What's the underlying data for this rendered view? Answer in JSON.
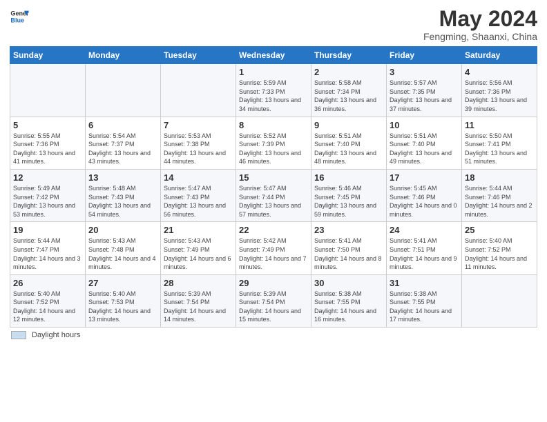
{
  "logo": {
    "line1": "General",
    "line2": "Blue"
  },
  "title": "May 2024",
  "subtitle": "Fengming, Shaanxi, China",
  "header": {
    "days": [
      "Sunday",
      "Monday",
      "Tuesday",
      "Wednesday",
      "Thursday",
      "Friday",
      "Saturday"
    ]
  },
  "footer": {
    "legend_label": "Daylight hours"
  },
  "weeks": [
    [
      {
        "day": "",
        "info": ""
      },
      {
        "day": "",
        "info": ""
      },
      {
        "day": "",
        "info": ""
      },
      {
        "day": "1",
        "info": "Sunrise: 5:59 AM\nSunset: 7:33 PM\nDaylight: 13 hours\nand 34 minutes."
      },
      {
        "day": "2",
        "info": "Sunrise: 5:58 AM\nSunset: 7:34 PM\nDaylight: 13 hours\nand 36 minutes."
      },
      {
        "day": "3",
        "info": "Sunrise: 5:57 AM\nSunset: 7:35 PM\nDaylight: 13 hours\nand 37 minutes."
      },
      {
        "day": "4",
        "info": "Sunrise: 5:56 AM\nSunset: 7:36 PM\nDaylight: 13 hours\nand 39 minutes."
      }
    ],
    [
      {
        "day": "5",
        "info": "Sunrise: 5:55 AM\nSunset: 7:36 PM\nDaylight: 13 hours\nand 41 minutes."
      },
      {
        "day": "6",
        "info": "Sunrise: 5:54 AM\nSunset: 7:37 PM\nDaylight: 13 hours\nand 43 minutes."
      },
      {
        "day": "7",
        "info": "Sunrise: 5:53 AM\nSunset: 7:38 PM\nDaylight: 13 hours\nand 44 minutes."
      },
      {
        "day": "8",
        "info": "Sunrise: 5:52 AM\nSunset: 7:39 PM\nDaylight: 13 hours\nand 46 minutes."
      },
      {
        "day": "9",
        "info": "Sunrise: 5:51 AM\nSunset: 7:40 PM\nDaylight: 13 hours\nand 48 minutes."
      },
      {
        "day": "10",
        "info": "Sunrise: 5:51 AM\nSunset: 7:40 PM\nDaylight: 13 hours\nand 49 minutes."
      },
      {
        "day": "11",
        "info": "Sunrise: 5:50 AM\nSunset: 7:41 PM\nDaylight: 13 hours\nand 51 minutes."
      }
    ],
    [
      {
        "day": "12",
        "info": "Sunrise: 5:49 AM\nSunset: 7:42 PM\nDaylight: 13 hours\nand 53 minutes."
      },
      {
        "day": "13",
        "info": "Sunrise: 5:48 AM\nSunset: 7:43 PM\nDaylight: 13 hours\nand 54 minutes."
      },
      {
        "day": "14",
        "info": "Sunrise: 5:47 AM\nSunset: 7:43 PM\nDaylight: 13 hours\nand 56 minutes."
      },
      {
        "day": "15",
        "info": "Sunrise: 5:47 AM\nSunset: 7:44 PM\nDaylight: 13 hours\nand 57 minutes."
      },
      {
        "day": "16",
        "info": "Sunrise: 5:46 AM\nSunset: 7:45 PM\nDaylight: 13 hours\nand 59 minutes."
      },
      {
        "day": "17",
        "info": "Sunrise: 5:45 AM\nSunset: 7:46 PM\nDaylight: 14 hours\nand 0 minutes."
      },
      {
        "day": "18",
        "info": "Sunrise: 5:44 AM\nSunset: 7:46 PM\nDaylight: 14 hours\nand 2 minutes."
      }
    ],
    [
      {
        "day": "19",
        "info": "Sunrise: 5:44 AM\nSunset: 7:47 PM\nDaylight: 14 hours\nand 3 minutes."
      },
      {
        "day": "20",
        "info": "Sunrise: 5:43 AM\nSunset: 7:48 PM\nDaylight: 14 hours\nand 4 minutes."
      },
      {
        "day": "21",
        "info": "Sunrise: 5:43 AM\nSunset: 7:49 PM\nDaylight: 14 hours\nand 6 minutes."
      },
      {
        "day": "22",
        "info": "Sunrise: 5:42 AM\nSunset: 7:49 PM\nDaylight: 14 hours\nand 7 minutes."
      },
      {
        "day": "23",
        "info": "Sunrise: 5:41 AM\nSunset: 7:50 PM\nDaylight: 14 hours\nand 8 minutes."
      },
      {
        "day": "24",
        "info": "Sunrise: 5:41 AM\nSunset: 7:51 PM\nDaylight: 14 hours\nand 9 minutes."
      },
      {
        "day": "25",
        "info": "Sunrise: 5:40 AM\nSunset: 7:52 PM\nDaylight: 14 hours\nand 11 minutes."
      }
    ],
    [
      {
        "day": "26",
        "info": "Sunrise: 5:40 AM\nSunset: 7:52 PM\nDaylight: 14 hours\nand 12 minutes."
      },
      {
        "day": "27",
        "info": "Sunrise: 5:40 AM\nSunset: 7:53 PM\nDaylight: 14 hours\nand 13 minutes."
      },
      {
        "day": "28",
        "info": "Sunrise: 5:39 AM\nSunset: 7:54 PM\nDaylight: 14 hours\nand 14 minutes."
      },
      {
        "day": "29",
        "info": "Sunrise: 5:39 AM\nSunset: 7:54 PM\nDaylight: 14 hours\nand 15 minutes."
      },
      {
        "day": "30",
        "info": "Sunrise: 5:38 AM\nSunset: 7:55 PM\nDaylight: 14 hours\nand 16 minutes."
      },
      {
        "day": "31",
        "info": "Sunrise: 5:38 AM\nSunset: 7:55 PM\nDaylight: 14 hours\nand 17 minutes."
      },
      {
        "day": "",
        "info": ""
      }
    ]
  ]
}
